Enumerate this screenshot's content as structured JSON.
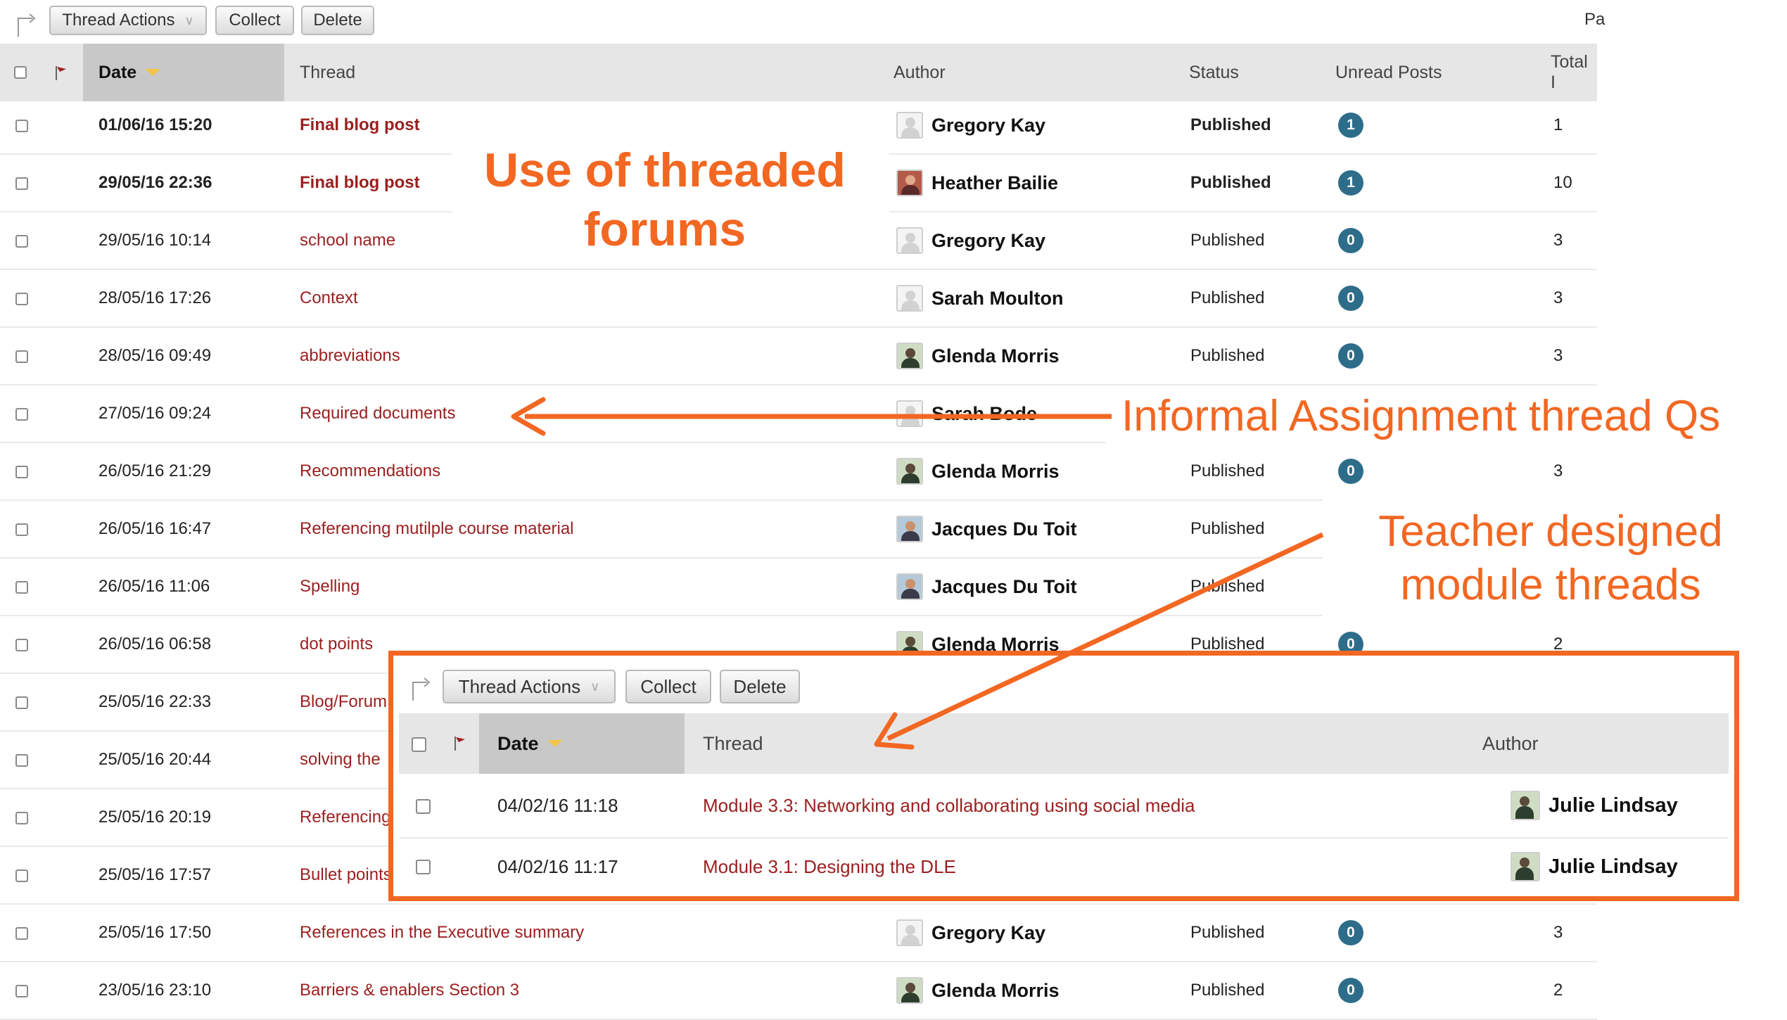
{
  "toolbar": {
    "thread_actions": "Thread Actions",
    "collect": "Collect",
    "delete": "Delete",
    "page_label": "Pa"
  },
  "table": {
    "headers": {
      "date": "Date",
      "thread": "Thread",
      "author": "Author",
      "status": "Status",
      "unread_posts": "Unread Posts",
      "total": "Total I"
    },
    "rows": [
      {
        "date": "01/06/16 15:20",
        "thread": "Final blog post",
        "author": "Gregory Kay",
        "status": "Published",
        "unread": "1",
        "total": "1"
      },
      {
        "date": "29/05/16 22:36",
        "thread": "Final blog post",
        "author": "Heather Bailie",
        "status": "Published",
        "unread": "1",
        "total": "10"
      },
      {
        "date": "29/05/16 10:14",
        "thread": "school name",
        "author": "Gregory Kay",
        "status": "Published",
        "unread": "0",
        "total": "3"
      },
      {
        "date": "28/05/16 17:26",
        "thread": "Context",
        "author": "Sarah Moulton",
        "status": "Published",
        "unread": "0",
        "total": "3"
      },
      {
        "date": "28/05/16 09:49",
        "thread": "abbreviations",
        "author": "Glenda Morris",
        "status": "Published",
        "unread": "0",
        "total": "3"
      },
      {
        "date": "27/05/16 09:24",
        "thread": "Required documents",
        "author": "Sarah Bode",
        "status": "",
        "unread": "",
        "total": ""
      },
      {
        "date": "26/05/16 21:29",
        "thread": "Recommendations",
        "author": "Glenda Morris",
        "status": "Published",
        "unread": "0",
        "total": "3"
      },
      {
        "date": "26/05/16 16:47",
        "thread": "Referencing mutilple course material",
        "author": "Jacques Du Toit",
        "status": "Published",
        "unread": "",
        "total": ""
      },
      {
        "date": "26/05/16 11:06",
        "thread": "Spelling",
        "author": "Jacques Du Toit",
        "status": "Published",
        "unread": "",
        "total": ""
      },
      {
        "date": "26/05/16 06:58",
        "thread": "dot points",
        "author": "Glenda Morris",
        "status": "Published",
        "unread": "0",
        "total": "2"
      },
      {
        "date": "25/05/16 22:33",
        "thread": "Blog/Forum",
        "author": "",
        "status": "",
        "unread": "",
        "total": ""
      },
      {
        "date": "25/05/16 20:44",
        "thread": "solving the",
        "author": "",
        "status": "",
        "unread": "",
        "total": ""
      },
      {
        "date": "25/05/16 20:19",
        "thread": "Referencing",
        "author": "",
        "status": "",
        "unread": "",
        "total": ""
      },
      {
        "date": "25/05/16 17:57",
        "thread": "Bullet points",
        "author": "",
        "status": "",
        "unread": "",
        "total": ""
      },
      {
        "date": "25/05/16 17:50",
        "thread": "References in the Executive summary",
        "author": "Gregory Kay",
        "status": "Published",
        "unread": "0",
        "total": "3"
      },
      {
        "date": "23/05/16 23:10",
        "thread": "Barriers & enablers Section 3",
        "author": "Glenda Morris",
        "status": "Published",
        "unread": "0",
        "total": "2"
      }
    ]
  },
  "inset": {
    "toolbar": {
      "thread_actions": "Thread Actions",
      "collect": "Collect",
      "delete": "Delete"
    },
    "headers": {
      "date": "Date",
      "thread": "Thread",
      "author": "Author"
    },
    "rows": [
      {
        "date": "04/02/16 11:18",
        "thread": "Module 3.3: Networking and collaborating using social media",
        "author": "Julie Lindsay"
      },
      {
        "date": "04/02/16 11:17",
        "thread": "Module 3.1: Designing the DLE",
        "author": "Julie Lindsay"
      }
    ]
  },
  "annotations": {
    "threaded_line1": "Use of threaded",
    "threaded_line2": "forums",
    "informal": "Informal Assignment thread Qs",
    "teacher_line1": "Teacher designed",
    "teacher_line2": "module threads"
  },
  "colors": {
    "annotation": "#f26722",
    "thread_link": "#9b1f1f",
    "badge": "#2d6d8a"
  }
}
